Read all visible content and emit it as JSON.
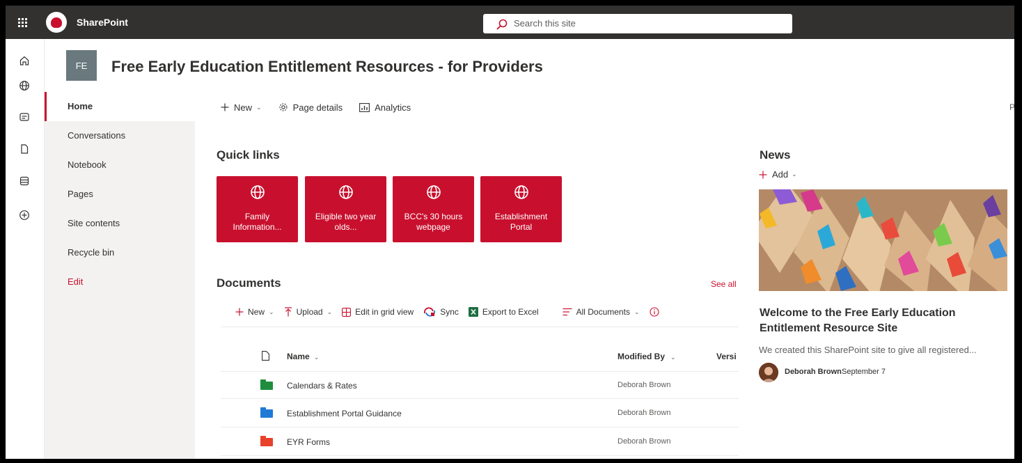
{
  "suite": {
    "app_name": "SharePoint",
    "search_placeholder": "Search this site"
  },
  "site": {
    "logo_initials": "FE",
    "title": "Free Early Education Entitlement Resources - for Providers"
  },
  "leftnav": {
    "items": [
      {
        "label": "Home",
        "selected": true
      },
      {
        "label": "Conversations"
      },
      {
        "label": "Notebook"
      },
      {
        "label": "Pages"
      },
      {
        "label": "Site contents"
      },
      {
        "label": "Recycle bin"
      },
      {
        "label": "Edit"
      }
    ]
  },
  "cmdbar": {
    "new_label": "New",
    "page_details_label": "Page details",
    "analytics_label": "Analytics",
    "edge_char": "P"
  },
  "quicklinks": {
    "title": "Quick links",
    "items": [
      {
        "label": "Family Information..."
      },
      {
        "label": "Eligible two year olds..."
      },
      {
        "label": "BCC's 30 hours webpage"
      },
      {
        "label": "Establishment Portal"
      }
    ]
  },
  "documents": {
    "title": "Documents",
    "see_all": "See all",
    "commands": {
      "new": "New",
      "upload": "Upload",
      "grid": "Edit in grid view",
      "sync": "Sync",
      "export": "Export to Excel",
      "view": "All Documents"
    },
    "columns": {
      "name": "Name",
      "modified_by": "Modified By",
      "version": "Versi"
    },
    "rows": [
      {
        "name": "Calendars & Rates",
        "modified_by": "Deborah Brown",
        "folder_color": "#1e8e3e"
      },
      {
        "name": "Establishment Portal Guidance",
        "modified_by": "Deborah Brown",
        "folder_color": "#1f7ad6"
      },
      {
        "name": "EYR Forms",
        "modified_by": "Deborah Brown",
        "folder_color": "#e8412c"
      }
    ]
  },
  "news": {
    "title": "News",
    "add_label": "Add",
    "headline": "Welcome to the Free Early Education Entitlement Resource Site",
    "description": "We created this SharePoint site to give all registered...",
    "author": "Deborah Brown",
    "date": "September 7"
  },
  "colors": {
    "accent": "#c8102e",
    "suitebar": "#323130",
    "nav_bg": "#f3f2f1"
  }
}
